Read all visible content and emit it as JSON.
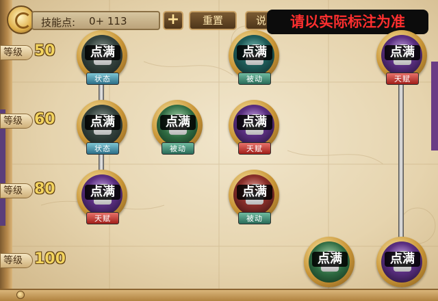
{
  "top_bar": {
    "points_label": "技能点:",
    "points_value": "0+ 113",
    "plus_label": "+",
    "reset_label": "重置",
    "help_label_partial": "说"
  },
  "overlay_note": "请以实际标注为准",
  "levels": [
    {
      "tag": "等级",
      "num": "50"
    },
    {
      "tag": "等级",
      "num": "60"
    },
    {
      "tag": "等级",
      "num": "80"
    },
    {
      "tag": "等级",
      "num": "100"
    }
  ],
  "skills": [
    {
      "status": "点满",
      "type": "状态"
    },
    {
      "status": "点满",
      "type": "被动"
    },
    {
      "status": "点满",
      "type": "天赋"
    },
    {
      "status": "点满",
      "type": "状态"
    },
    {
      "status": "点满",
      "type": "被动"
    },
    {
      "status": "点满",
      "type": "天赋"
    },
    {
      "status": "点满",
      "type": "天赋"
    },
    {
      "status": "点满",
      "type": "被动"
    },
    {
      "status": "点满",
      "type": ""
    },
    {
      "status": "点满",
      "type": ""
    }
  ],
  "colors": {
    "overlay_text": "#ff2f2f",
    "level_number": "#f3d45e",
    "ribbon_status": "#2c6f88",
    "ribbon_passive": "#2a6c59",
    "ribbon_talent": "#a11f1a"
  }
}
